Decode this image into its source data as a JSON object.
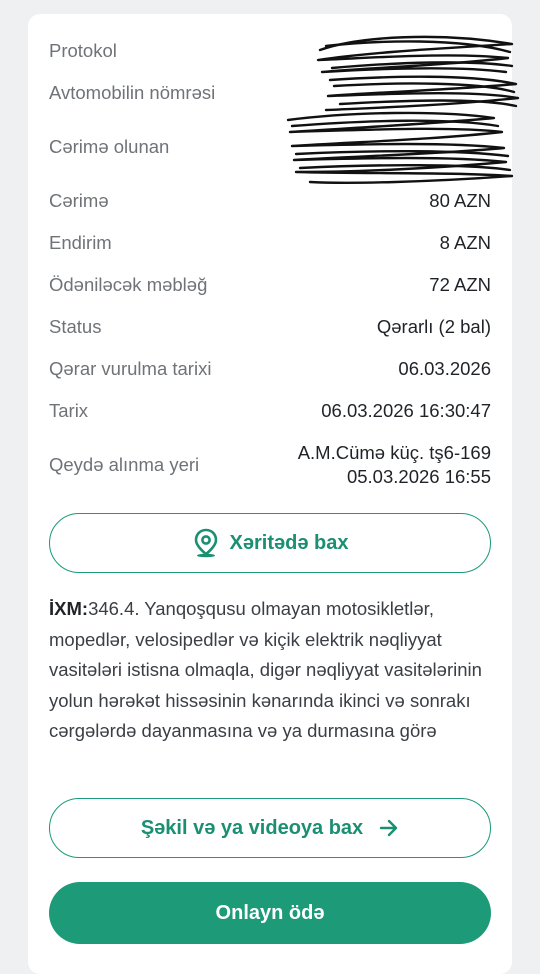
{
  "details": {
    "protocol_label": "Protokol",
    "plate_label": "Avtomobilin nömrəsi",
    "fined_label": "Cərimə olunan",
    "fine_label": "Cərimə",
    "fine_value": "80 AZN",
    "discount_label": "Endirim",
    "discount_value": "8 AZN",
    "payable_label": "Ödəniləcək məbləğ",
    "payable_value": "72 AZN",
    "status_label": "Status",
    "status_value": "Qərarlı (2 bal)",
    "decision_date_label": "Qərar vurulma tarixi",
    "decision_date_value": "06.03.2026",
    "date_label": "Tarix",
    "date_value": "06.03.2026 16:30:47",
    "location_label": "Qeydə alınma yeri",
    "location_line1": "A.M.Cümə küç. tş6-169",
    "location_line2": "05.03.2026 16:55"
  },
  "buttons": {
    "map_label": "Xəritədə bax",
    "media_label": "Şəkil və ya videoya bax",
    "pay_label": "Onlayn ödə"
  },
  "violation": {
    "code": "İXM:",
    "text": "346.4. Yanqoşqusu olmayan motosikletlər, mopedlər, velosipedlər və kiçik elektrik nəqliyyat vasitələri istisna olmaqla, digər nəqliyyat vasitələrinin yolun hərəkət hissəsinin kənarında ikinci və sonrakı cərgələrdə dayanmasına və ya durmasına görə"
  },
  "icons": {
    "map": "map-pin-icon",
    "arrow": "arrow-right-icon"
  },
  "colors": {
    "accent": "#1d9a78",
    "accent_text": "#1a8f72",
    "label": "#6f7378",
    "background": "#eef0f2"
  }
}
